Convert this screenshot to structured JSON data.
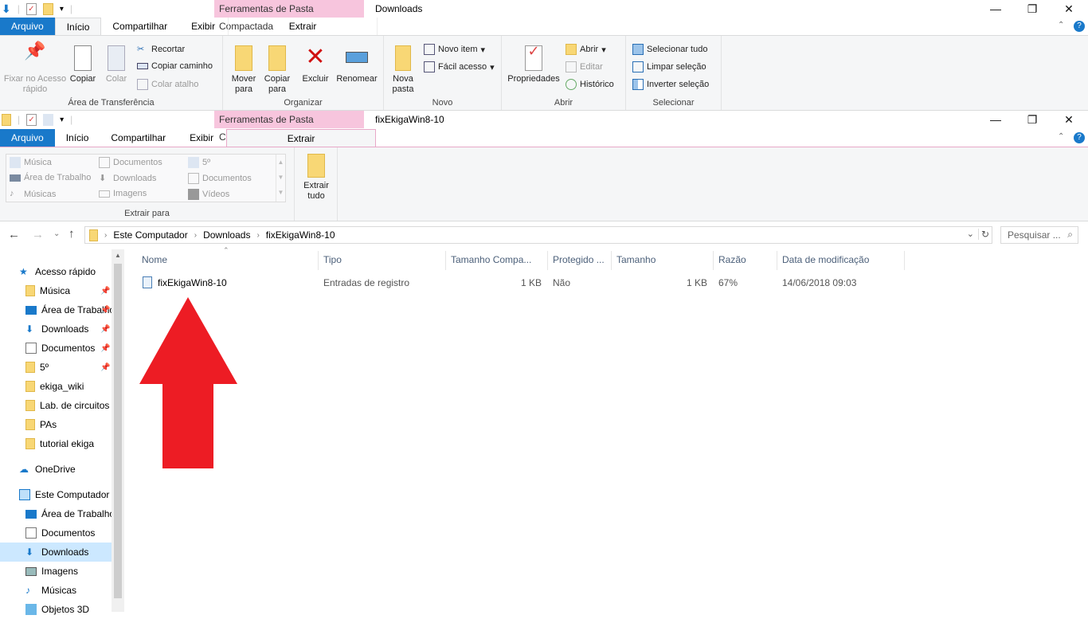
{
  "window1": {
    "title": "Downloads",
    "context_tab_header": "Ferramentas de Pasta Compactada",
    "tabs": [
      "Arquivo",
      "Início",
      "Compartilhar",
      "Exibir",
      "Extrair"
    ],
    "ribbon": {
      "clipboard": {
        "pin": "Fixar no Acesso rápido",
        "copy": "Copiar",
        "paste": "Colar",
        "cut": "Recortar",
        "copy_path": "Copiar caminho",
        "paste_shortcut": "Colar atalho",
        "label": "Área de Transferência"
      },
      "organize": {
        "move": "Mover para",
        "copyto": "Copiar para",
        "delete": "Excluir",
        "rename": "Renomear",
        "label": "Organizar"
      },
      "new": {
        "new_folder": "Nova pasta",
        "new_item": "Novo item",
        "easy_access": "Fácil acesso",
        "label": "Novo"
      },
      "open": {
        "properties": "Propriedades",
        "open": "Abrir",
        "edit": "Editar",
        "history": "Histórico",
        "label": "Abrir"
      },
      "select": {
        "all": "Selecionar tudo",
        "none": "Limpar seleção",
        "invert": "Inverter seleção",
        "label": "Selecionar"
      }
    }
  },
  "window2": {
    "title": "fixEkigaWin8-10",
    "context_tab_header": "Ferramentas de Pasta Compactada",
    "tabs": [
      "Arquivo",
      "Início",
      "Compartilhar",
      "Exibir",
      "Extrair"
    ],
    "extract_to": {
      "items": [
        "Música",
        "Documentos",
        "5º",
        "Área de Trabalho",
        "Downloads",
        "Documentos",
        "Músicas",
        "Imagens",
        "Vídeos"
      ],
      "label": "Extrair para"
    },
    "extract_all": "Extrair tudo",
    "breadcrumb": [
      "Este Computador",
      "Downloads",
      "fixEkigaWin8-10"
    ],
    "search_placeholder": "Pesquisar ...",
    "sidebar": [
      {
        "label": "Acesso rápido",
        "type": "header"
      },
      {
        "label": "Música",
        "pinned": true
      },
      {
        "label": "Área de Trabalho",
        "pinned": true
      },
      {
        "label": "Downloads",
        "pinned": true
      },
      {
        "label": "Documentos",
        "pinned": true
      },
      {
        "label": "5º",
        "pinned": true
      },
      {
        "label": "ekiga_wiki"
      },
      {
        "label": "Lab. de circuitos"
      },
      {
        "label": "PAs"
      },
      {
        "label": "tutorial ekiga"
      },
      {
        "label": "OneDrive",
        "type": "header"
      },
      {
        "label": "Este Computador",
        "type": "header"
      },
      {
        "label": "Área de Trabalho"
      },
      {
        "label": "Documentos"
      },
      {
        "label": "Downloads",
        "selected": true
      },
      {
        "label": "Imagens"
      },
      {
        "label": "Músicas"
      },
      {
        "label": "Objetos 3D"
      }
    ],
    "columns": [
      "Nome",
      "Tipo",
      "Tamanho Compa...",
      "Protegido ...",
      "Tamanho",
      "Razão",
      "Data de modificação"
    ],
    "rows": [
      {
        "name": "fixEkigaWin8-10",
        "type": "Entradas de registro",
        "compressed": "1 KB",
        "protected": "Não",
        "size": "1 KB",
        "ratio": "67%",
        "modified": "14/06/2018 09:03"
      }
    ]
  },
  "colors": {
    "accent": "#1979ca",
    "context": "#f7c5dd",
    "arrow": "#ed1c24"
  }
}
